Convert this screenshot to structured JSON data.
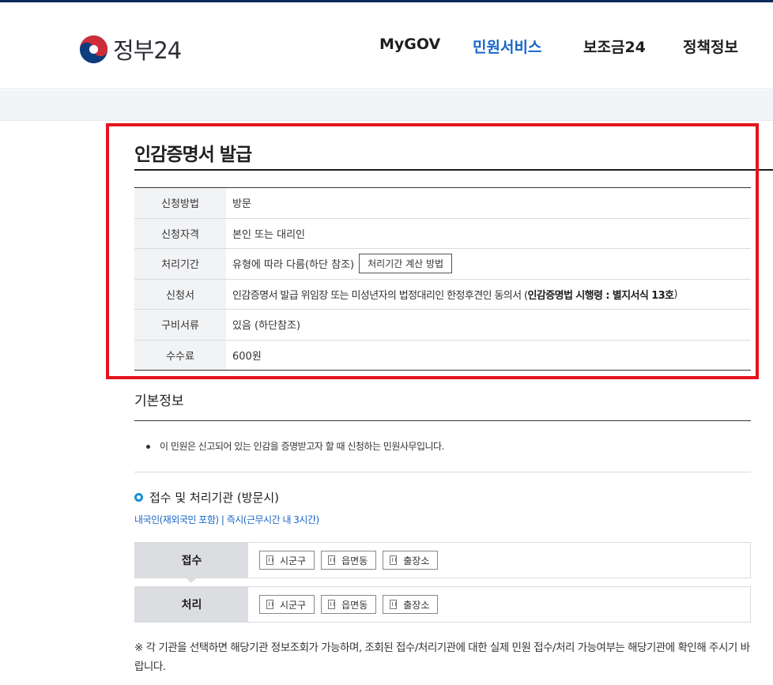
{
  "header": {
    "logo_text": "정부24",
    "nav": [
      "MyGOV",
      "민원서비스",
      "보조금24",
      "정책정보"
    ],
    "active_nav": "민원서비스"
  },
  "page": {
    "title": "인감증명서 발급"
  },
  "info": {
    "rows": [
      {
        "label": "신청방법",
        "value": "방문"
      },
      {
        "label": "신청자격",
        "value": "본인 또는 대리인"
      },
      {
        "label": "처리기간",
        "value": "유형에 따라 다름(하단 참조)",
        "button": "처리기간 계산 방법"
      },
      {
        "label": "신청서",
        "value": "인감증명서 발급 위임장 또는 미성년자의 법정대리인 한정후견인 동의서 (",
        "bold": "인감증명법 시행령 : 별지서식 13호",
        "value_end": ")"
      },
      {
        "label": "구비서류",
        "value": "있음 (하단참조)"
      },
      {
        "label": "수수료",
        "value": "600원"
      }
    ]
  },
  "basic": {
    "title": "기본정보",
    "bullet": "이 민원은 신고되어 있는 인감을 증명받고자 할 때 신청하는 민원사무입니다."
  },
  "agency": {
    "title": "접수 및 처리기관 (방문시)",
    "note": "내국인(재외국민 포함) | 즉시(근무시간 내 3시간)",
    "receive_label": "접수",
    "process_label": "처리",
    "orgs": [
      "시군구",
      "읍면동",
      "출장소"
    ]
  },
  "footnote": "※ 각 기관을 선택하면 해당기관 정보조회가 가능하며, 조회된 접수/처리기관에 대한 실제 민원 접수/처리 가능여부는 해당기관에 확인해 주시기 바랍니다.",
  "colors": {
    "accent": "#1766c9",
    "highlight_border": "#e4141c",
    "logo_red": "#cd2e3a",
    "logo_blue": "#0f3c7d"
  }
}
